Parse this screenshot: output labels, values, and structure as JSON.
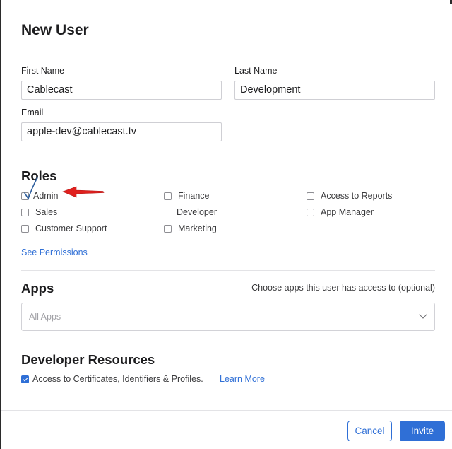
{
  "dialog": {
    "title": "New User"
  },
  "form": {
    "first_name": {
      "label": "First Name",
      "value": "Cablecast"
    },
    "last_name": {
      "label": "Last Name",
      "value": "Development"
    },
    "email": {
      "label": "Email",
      "value": "apple-dev@cablecast.tv"
    }
  },
  "roles": {
    "heading": "Roles",
    "items": [
      {
        "label": "Admin",
        "checked": false
      },
      {
        "label": "Finance",
        "checked": false
      },
      {
        "label": "Access to Reports",
        "checked": false
      },
      {
        "label": "Sales",
        "checked": false
      },
      {
        "label": "Developer",
        "checked": false
      },
      {
        "label": "App Manager",
        "checked": false
      },
      {
        "label": "Customer Support",
        "checked": false
      },
      {
        "label": "Marketing",
        "checked": false
      }
    ],
    "permissions_link": "See Permissions"
  },
  "apps": {
    "heading": "Apps",
    "hint": "Choose apps this user has access to (optional)",
    "select_placeholder": "All Apps"
  },
  "developer_resources": {
    "heading": "Developer Resources",
    "checkbox_label": "Access to Certificates, Identifiers & Profiles.",
    "checked": true,
    "learn_more": "Learn More"
  },
  "footer": {
    "cancel": "Cancel",
    "invite": "Invite"
  },
  "colors": {
    "accent": "#2f6fd6",
    "annotation_arrow": "#e0201e",
    "annotation_mark": "#2e5f9e"
  }
}
